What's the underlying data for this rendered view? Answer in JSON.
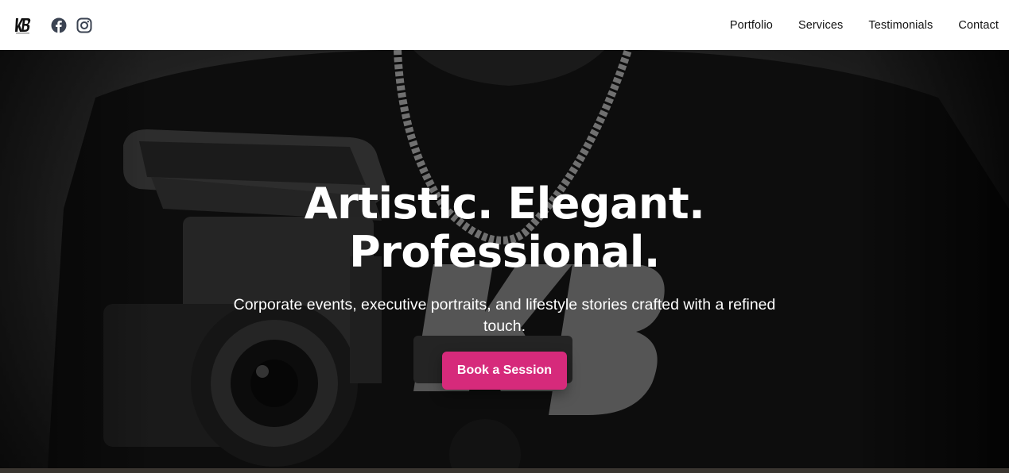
{
  "header": {
    "logo_text": "KB",
    "social": [
      {
        "name": "facebook-icon"
      },
      {
        "name": "instagram-icon"
      }
    ],
    "nav": [
      {
        "label": "Portfolio"
      },
      {
        "label": "Services"
      },
      {
        "label": "Testimonials"
      },
      {
        "label": "Contact"
      }
    ]
  },
  "hero": {
    "title_line1": "Artistic. Elegant.",
    "title_line2": "Professional.",
    "subtitle": "Corporate events, executive portraits, and lifestyle stories crafted with a refined touch.",
    "cta_label": "Book a Session",
    "image_description_icon": "camera-operator-photo"
  },
  "colors": {
    "accent": "#d62a7b",
    "header_bg": "#ffffff",
    "nav_text": "#111111",
    "hero_text": "#ffffff"
  }
}
